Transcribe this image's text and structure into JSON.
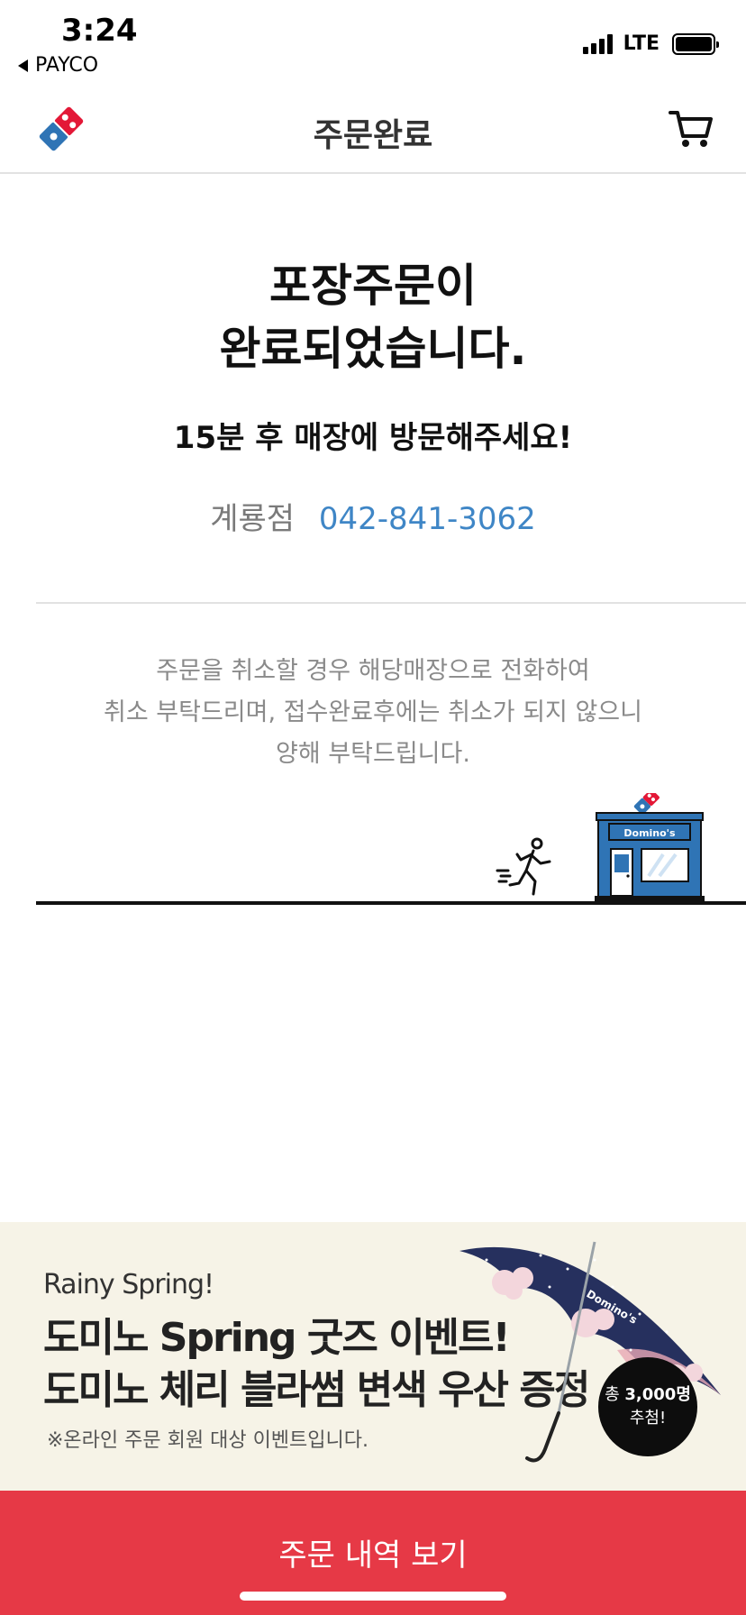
{
  "status_bar": {
    "time": "3:24",
    "back_app": "PAYCO",
    "network": "LTE",
    "icons": [
      "signal-icon",
      "battery-icon"
    ]
  },
  "header": {
    "title": "주문완료",
    "logo_icon": "dominos-logo-icon",
    "cart_icon": "cart-icon"
  },
  "main": {
    "title_line1": "포장주문이",
    "title_line2": "완료되었습니다.",
    "subtitle": "15분 후 매장에 방문해주세요!",
    "store_name": "계룡점",
    "store_phone": "042-841-3062",
    "notice_line1": "주문을 취소할 경우 해당매장으로 전화하여",
    "notice_line2": "취소 부탁드리며, 접수완료후에는 취소가 되지 않으니",
    "notice_line3": "양해 부탁드립니다."
  },
  "illustration": {
    "shop_sign": "Domino's",
    "icons": [
      "running-person-icon",
      "store-icon"
    ]
  },
  "banner": {
    "eyebrow": "Rainy Spring!",
    "title_line1": "도미노 Spring 굿즈 이벤트!",
    "title_line2": "도미노 체리 블라썸 변색 우산 증정",
    "note": "※온라인 주문 회원 대상 이벤트입니다.",
    "badge_line1_prefix": "총 ",
    "badge_line1_count": "3,000명",
    "badge_line2": "추첨!",
    "umbrella_text": "Domino's"
  },
  "cta": {
    "label": "주문 내역 보기"
  },
  "colors": {
    "brand_red": "#e63946",
    "brand_blue": "#2f74b5",
    "phone_blue": "#3f86c6",
    "banner_bg": "#f6f3e7"
  }
}
